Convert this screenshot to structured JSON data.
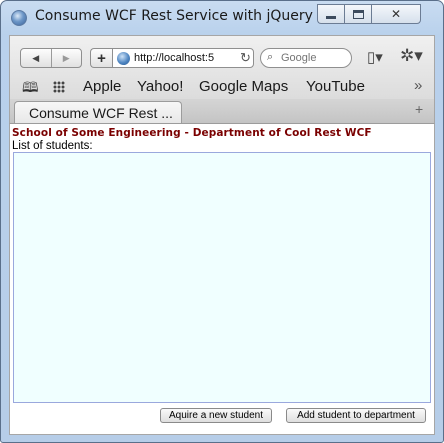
{
  "window": {
    "title": "Consume WCF Rest Service with jQuery",
    "controls": {
      "minimize": "minimize",
      "maximize": "maximize",
      "close": "✕"
    }
  },
  "toolbar": {
    "back": "◀",
    "forward": "▶",
    "add": "+",
    "address": "http://localhost:5",
    "reload": "↻",
    "search_placeholder": "Google",
    "page_menu": "▯▾",
    "gear_menu": "✲▾"
  },
  "bookmarks": {
    "reading_list": "📖",
    "items": [
      "Apple",
      "Yahoo!",
      "Google Maps",
      "YouTube"
    ],
    "overflow": "»"
  },
  "tabs": [
    {
      "label": "Consume WCF Rest ..."
    }
  ],
  "new_tab": "+",
  "page": {
    "title": "School of Some Engineering - Department of Cool Rest WCF",
    "list_label": "List of students:",
    "buttons": {
      "acquire": "Aquire a new student",
      "add": "Add student to department"
    }
  }
}
